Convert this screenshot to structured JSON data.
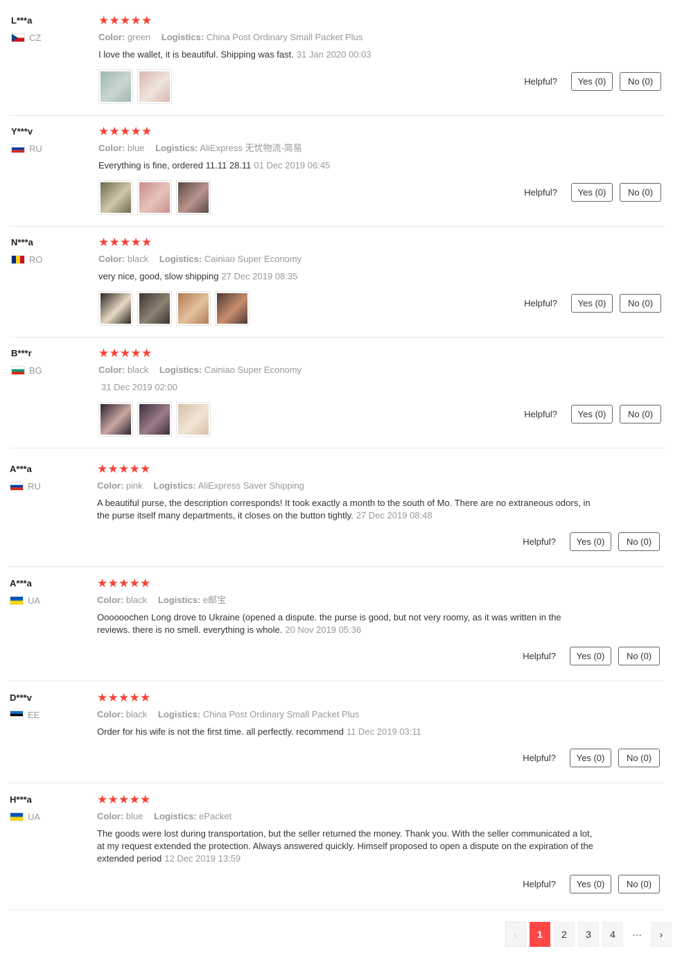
{
  "labels": {
    "color": "Color:",
    "logistics": "Logistics:",
    "helpful": "Helpful?"
  },
  "reviews": [
    {
      "user": "L***a",
      "country": "CZ",
      "flag": [
        "#ffffff",
        "#d7141a",
        "#11457e"
      ],
      "flag_type": "cz",
      "rating": 5,
      "color": "green",
      "logistics": "China Post Ordinary Small Packet Plus",
      "text": "I love the wallet, it is beautiful. Shipping was fast.",
      "date": "31 Jan 2020 00:03",
      "photos": [
        [
          "#9fb8b0",
          "#c9d6cf"
        ],
        [
          "#d9b8b0",
          "#efe3dd"
        ]
      ],
      "yes": "Yes (0)",
      "no": "No (0)"
    },
    {
      "user": "Y***v",
      "country": "RU",
      "flag": [
        "#ffffff",
        "#0039a6",
        "#d52b1e"
      ],
      "flag_type": "h3",
      "rating": 5,
      "color": "blue",
      "logistics": "AliExpress 无忧物流-简易",
      "text": "Everything is fine, ordered 11.11 28.11",
      "date": "01 Dec 2019 06:45",
      "photos": [
        [
          "#6d6a4e",
          "#cfc8a9"
        ],
        [
          "#c98f8a",
          "#e6c2bb"
        ],
        [
          "#5b4a45",
          "#b9938c"
        ]
      ],
      "yes": "Yes (0)",
      "no": "No (0)"
    },
    {
      "user": "N***a",
      "country": "RO",
      "flag": [
        "#002b7f",
        "#fcd116",
        "#ce1126"
      ],
      "flag_type": "v3",
      "rating": 5,
      "color": "black",
      "logistics": "Cainiao Super Economy",
      "text": "very nice, good, slow shipping",
      "date": "27 Dec 2019 08:35",
      "photos": [
        [
          "#2d2624",
          "#e8d9c4"
        ],
        [
          "#3a3330",
          "#8e8272"
        ],
        [
          "#b27a55",
          "#e2c29c"
        ],
        [
          "#4c3a34",
          "#c98d6e"
        ]
      ],
      "yes": "Yes (0)",
      "no": "No (0)"
    },
    {
      "user": "B***r",
      "country": "BG",
      "flag": [
        "#ffffff",
        "#00966e",
        "#d62612"
      ],
      "flag_type": "h3",
      "rating": 5,
      "color": "black",
      "logistics": "Cainiao Super Economy",
      "text": "",
      "date": "31 Dec 2019 02:00",
      "photos": [
        [
          "#2a2330",
          "#c9a8a0"
        ],
        [
          "#3b2f3a",
          "#9c7c8a"
        ],
        [
          "#d8c0a8",
          "#f0e4d4"
        ]
      ],
      "yes": "Yes (0)",
      "no": "No (0)"
    },
    {
      "user": "A***a",
      "country": "RU",
      "flag": [
        "#ffffff",
        "#0039a6",
        "#d52b1e"
      ],
      "flag_type": "h3",
      "rating": 5,
      "color": "pink",
      "logistics": "AliExpress Saver Shipping",
      "text": "A beautiful purse, the description corresponds! It took exactly a month to the south of Mo. There are no extraneous odors, in the purse itself many departments, it closes on the button tightly.",
      "date": "27 Dec 2019 08:48",
      "photos": [],
      "yes": "Yes (0)",
      "no": "No (0)"
    },
    {
      "user": "A***a",
      "country": "UA",
      "flag": [
        "#0057b7",
        "#ffd700"
      ],
      "flag_type": "h2",
      "rating": 5,
      "color": "black",
      "logistics": "e邮宝",
      "text": "Oooooochen Long drove to Ukraine (opened a dispute. the purse is good, but not very roomy, as it was written in the reviews. there is no smell. everything is whole.",
      "date": "20 Nov 2019 05:36",
      "photos": [],
      "yes": "Yes (0)",
      "no": "No (0)"
    },
    {
      "user": "D***v",
      "country": "EE",
      "flag": [
        "#0072ce",
        "#000000",
        "#ffffff"
      ],
      "flag_type": "h3",
      "rating": 5,
      "color": "black",
      "logistics": "China Post Ordinary Small Packet Plus",
      "text": "Order for his wife is not the first time. all perfectly. recommend",
      "date": "11 Dec 2019 03:11",
      "photos": [],
      "yes": "Yes (0)",
      "no": "No (0)"
    },
    {
      "user": "H***a",
      "country": "UA",
      "flag": [
        "#0057b7",
        "#ffd700"
      ],
      "flag_type": "h2",
      "rating": 5,
      "color": "blue",
      "logistics": "ePacket",
      "text": "The goods were lost during transportation, but the seller returned the money. Thank you. With the seller communicated a lot, at my request extended the protection. Always answered quickly. Himself proposed to open a dispute on the expiration of the extended period",
      "date": "12 Dec 2019 13:59",
      "photos": [],
      "yes": "Yes (0)",
      "no": "No (0)"
    }
  ],
  "pagination": {
    "prev": "‹",
    "pages": [
      "1",
      "2",
      "3",
      "4"
    ],
    "current": "1",
    "ellipsis": "···",
    "next": "›"
  }
}
